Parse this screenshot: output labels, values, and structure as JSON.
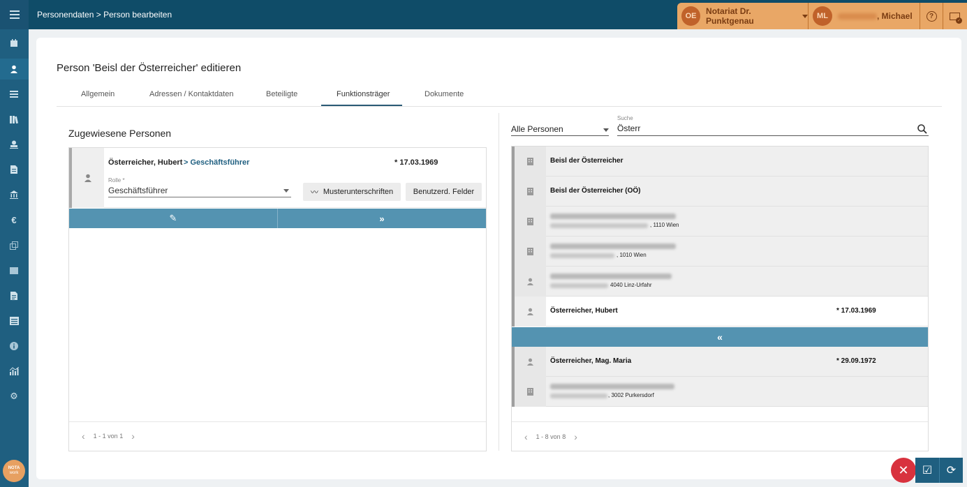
{
  "topbar": {
    "breadcrumb": "Personendaten > Person bearbeiten",
    "office_initials": "OE",
    "office_name": "Notariat Dr. Punktgenau",
    "user_initials": "ML",
    "user_name": ", Michael"
  },
  "page": {
    "title": "Person 'Beisl der Österreicher' editieren",
    "tabs": [
      "Allgemein",
      "Adressen / Kontaktdaten",
      "Beteiligte",
      "Funktionsträger",
      "Dokumente"
    ],
    "active_tab": "Funktionsträger"
  },
  "left": {
    "section_title": "Zugewiesene Personen",
    "person": {
      "name": "Österreicher, Hubert",
      "role_link": "> Geschäftsführer",
      "birthdate": "* 17.03.1969",
      "role_label": "Rolle *",
      "role_value": "Geschäftsführer",
      "signatures_button": "Musterunterschriften",
      "custom_fields_button": "Benutzerd. Felder"
    },
    "pager": "1 - 1 von 1"
  },
  "right": {
    "filter_value": "Alle Personen",
    "search_label": "Suche",
    "search_value": "Österr",
    "results": [
      {
        "type": "company",
        "name": "Beisl der Österreicher",
        "birthdate": ""
      },
      {
        "type": "company",
        "name": "Beisl der Österreicher (OÖ)",
        "birthdate": ""
      },
      {
        "type": "company",
        "address": ", 1110 Wien"
      },
      {
        "type": "company",
        "address": ", 1010 Wien"
      },
      {
        "type": "person",
        "address": "4040 Linz-Urfahr"
      },
      {
        "type": "person",
        "name": "Österreicher, Hubert",
        "birthdate": "* 17.03.1969"
      },
      {
        "type": "person",
        "name": "Österreicher, Mag. Maria",
        "birthdate": "* 29.09.1972"
      },
      {
        "type": "company",
        "address": ", 3002 Purkersdorf"
      }
    ],
    "pager": "1 - 8 von 8"
  },
  "logo": {
    "line1": "NOTA",
    "line2": "work"
  }
}
